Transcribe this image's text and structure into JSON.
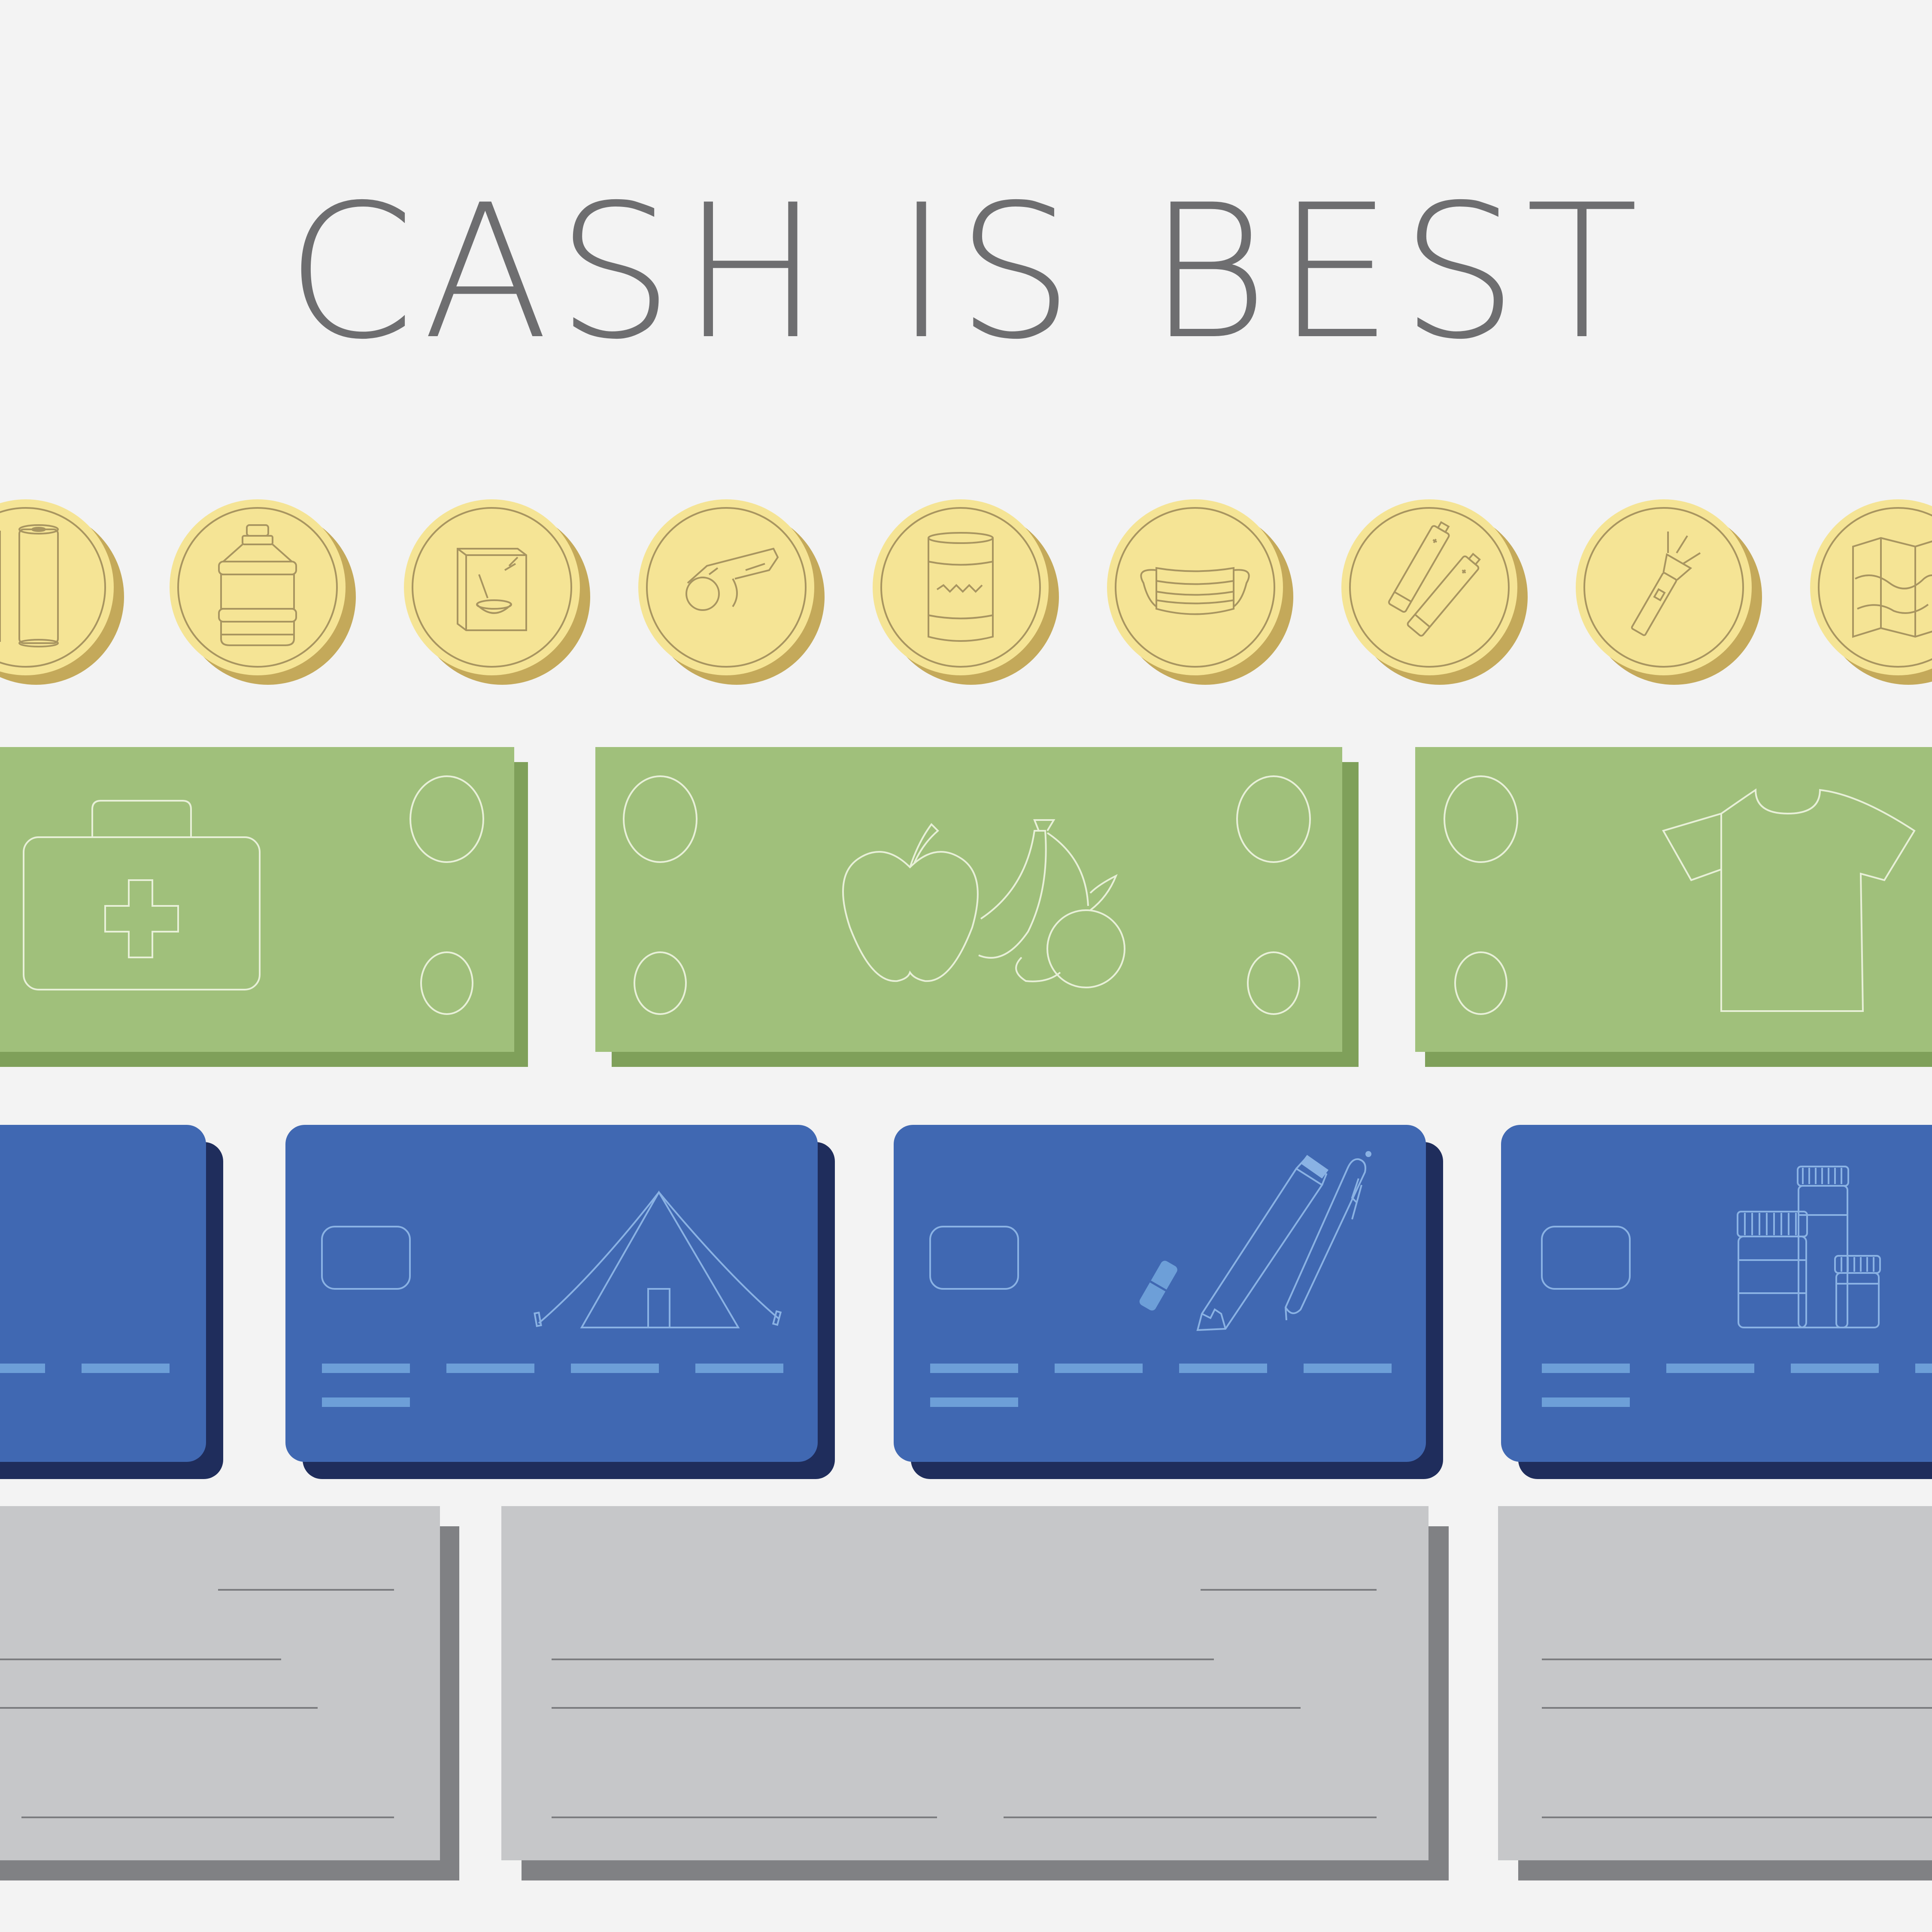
{
  "title": "CASH IS BEST",
  "colors": {
    "background": "#f3f3f3",
    "title": "#6e6e70",
    "coin_face": "#f5e495",
    "coin_shadow": "#c4a95a",
    "coin_line": "#a89560",
    "bill_face": "#a0c07b",
    "bill_shadow": "#7fa05a",
    "bill_line": "#e8f0d8",
    "card_face": "#4068b2",
    "card_shadow": "#1f2d5c",
    "card_stripe": "#6d9fd8",
    "card_line": "#8ab2e4",
    "check_face": "#c6c7c9",
    "check_shadow": "#808184",
    "check_line": "#7b7c7f"
  },
  "coins": [
    {
      "icon": "paper-towel-icon"
    },
    {
      "icon": "water-jug-icon"
    },
    {
      "icon": "cereal-box-icon"
    },
    {
      "icon": "whistle-icon"
    },
    {
      "icon": "canned-food-icon"
    },
    {
      "icon": "face-mask-icon"
    },
    {
      "icon": "batteries-icon"
    },
    {
      "icon": "flashlight-icon"
    },
    {
      "icon": "map-icon"
    }
  ],
  "bills": [
    {
      "icon": "first-aid-kit-icon"
    },
    {
      "icon": "fruit-icon"
    },
    {
      "icon": "t-shirt-icon"
    }
  ],
  "cards": [
    {
      "icon": ""
    },
    {
      "icon": "tent-icon"
    },
    {
      "icon": "pencil-pen-eraser-icon"
    },
    {
      "icon": "medicine-bottles-icon"
    }
  ],
  "checks": [
    {
      "icon": ""
    },
    {
      "icon": ""
    },
    {
      "icon": ""
    }
  ]
}
